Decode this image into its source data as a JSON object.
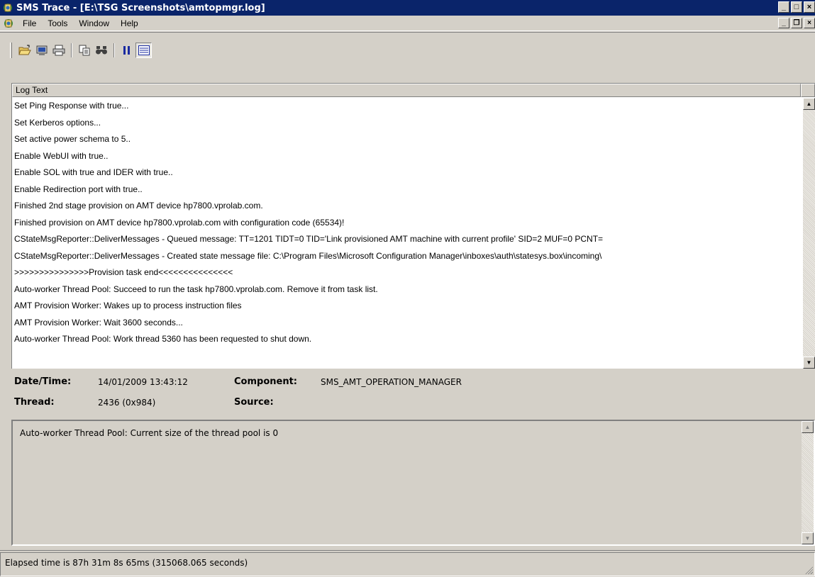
{
  "window": {
    "title": "SMS Trace - [E:\\TSG Screenshots\\amtopmgr.log]",
    "buttons": {
      "minimize": "_",
      "maximize": "□",
      "close": "×"
    }
  },
  "menu": {
    "items": [
      {
        "label": "File"
      },
      {
        "label": "Tools"
      },
      {
        "label": "Window"
      },
      {
        "label": "Help"
      }
    ],
    "mdi_buttons": {
      "minimize": "_",
      "restore": "❐",
      "close": "×"
    }
  },
  "toolbar": {
    "tools": [
      {
        "name": "open-icon"
      },
      {
        "name": "open-server-icon"
      },
      {
        "name": "print-icon"
      },
      {
        "name": "copy-icon"
      },
      {
        "name": "find-icon"
      },
      {
        "name": "pause-icon"
      },
      {
        "name": "details-icon"
      }
    ]
  },
  "log": {
    "column_header": "Log Text",
    "rows": [
      "Set Ping Response with true...",
      "Set Kerberos options...",
      "Set active power schema to  5..",
      "Enable WebUI with true..",
      "Enable SOL with true and IDER with true..",
      "Enable Redirection port with true..",
      "Finished 2nd stage provision on AMT device hp7800.vprolab.com.",
      "Finished provision on AMT device hp7800.vprolab.com with configuration code (65534)!",
      "CStateMsgReporter::DeliverMessages - Queued message: TT=1201 TIDT=0 TID='Link provisioned AMT machine with current profile' SID=2 MUF=0 PCNT=",
      "CStateMsgReporter::DeliverMessages - Created state message file: C:\\Program Files\\Microsoft Configuration Manager\\inboxes\\auth\\statesys.box\\incoming\\",
      ">>>>>>>>>>>>>>>Provision task end<<<<<<<<<<<<<<<",
      "Auto-worker Thread Pool: Succeed to run the task hp7800.vprolab.com. Remove it from task list.",
      "AMT Provision Worker: Wakes up to process instruction files",
      "AMT Provision Worker: Wait 3600 seconds...",
      "Auto-worker Thread Pool: Work thread 5360 has been requested to shut down."
    ]
  },
  "details": {
    "datetime_label": "Date/Time:",
    "datetime_value": "14/01/2009 13:43:12",
    "component_label": "Component:",
    "component_value": "SMS_AMT_OPERATION_MANAGER",
    "thread_label": "Thread:",
    "thread_value": "2436 (0x984)",
    "source_label": "Source:",
    "source_value": ""
  },
  "message": {
    "text": "Auto-worker Thread Pool: Current size of the thread pool is 0"
  },
  "status": {
    "text": "Elapsed time is 87h 31m 8s 65ms (315068.065 seconds)"
  },
  "scroll_arrows": {
    "up": "▲",
    "down": "▼"
  }
}
